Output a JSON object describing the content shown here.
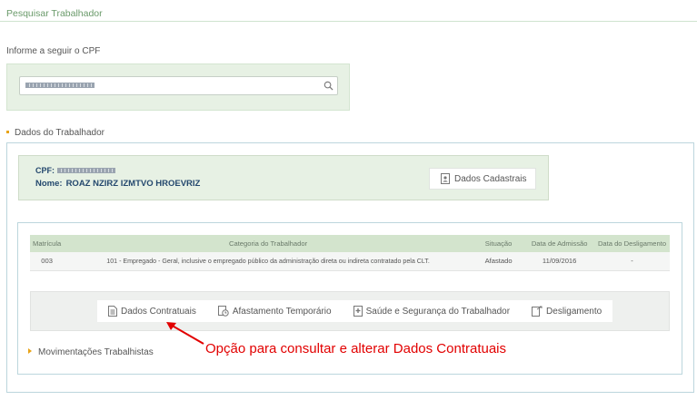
{
  "header": {
    "title": "Pesquisar Trabalhador"
  },
  "search": {
    "label": "Informe a seguir o CPF",
    "icon": "search-icon"
  },
  "section": {
    "title": "Dados do Trabalhador"
  },
  "worker": {
    "cpf_label": "CPF:",
    "name_label": "Nome:",
    "name": "ROAZ NZIRZ IZMTVO HROEVRIZ",
    "cadastrais_button": "Dados Cadastrais"
  },
  "table": {
    "columns": [
      "Matrícula",
      "Categoria do Trabalhador",
      "Situação",
      "Data de Admissão",
      "Data do Desligamento"
    ],
    "rows": [
      {
        "matricula": "003",
        "categoria": "101 - Empregado - Geral, inclusive o empregado público da administração direta ou indireta contratado pela CLT.",
        "situacao": "Afastado",
        "admissao": "11/09/2016",
        "desligamento": "-"
      }
    ]
  },
  "actions": {
    "dados_contratuais": "Dados Contratuais",
    "afastamento": "Afastamento Temporário",
    "saude": "Saúde e Segurança do Trabalhador",
    "desligamento": "Desligamento"
  },
  "movimentacoes": {
    "label": "Movimentações Trabalhistas"
  },
  "annotation": {
    "text": "Opção para consultar e alterar Dados Contratuais",
    "color": "#e20000"
  },
  "colors": {
    "accent_green": "#d3e4cd",
    "name_blue": "#24486e",
    "bullet_orange": "#e8a317"
  }
}
